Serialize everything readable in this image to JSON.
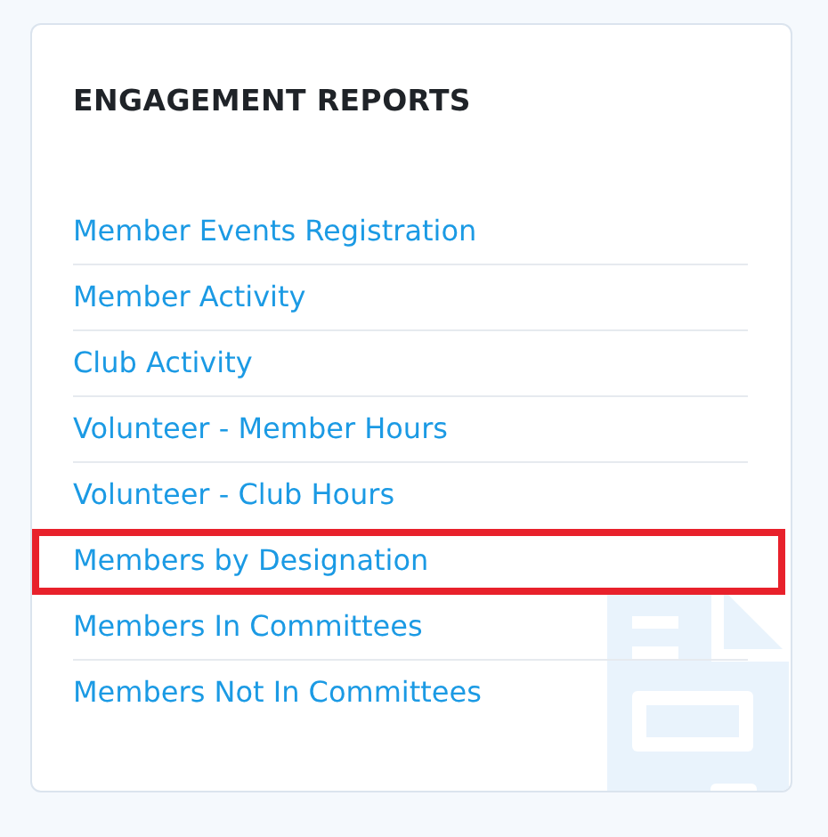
{
  "card": {
    "title": "ENGAGEMENT REPORTS",
    "reports": [
      {
        "label": "Member Events Registration",
        "highlighted": false
      },
      {
        "label": "Member Activity",
        "highlighted": false
      },
      {
        "label": "Club Activity",
        "highlighted": false
      },
      {
        "label": "Volunteer - Member Hours",
        "highlighted": false
      },
      {
        "label": "Volunteer - Club Hours",
        "highlighted": false
      },
      {
        "label": "Members by Designation",
        "highlighted": true
      },
      {
        "label": "Members In Committees",
        "highlighted": false
      },
      {
        "label": "Members Not In Committees",
        "highlighted": false
      }
    ]
  }
}
